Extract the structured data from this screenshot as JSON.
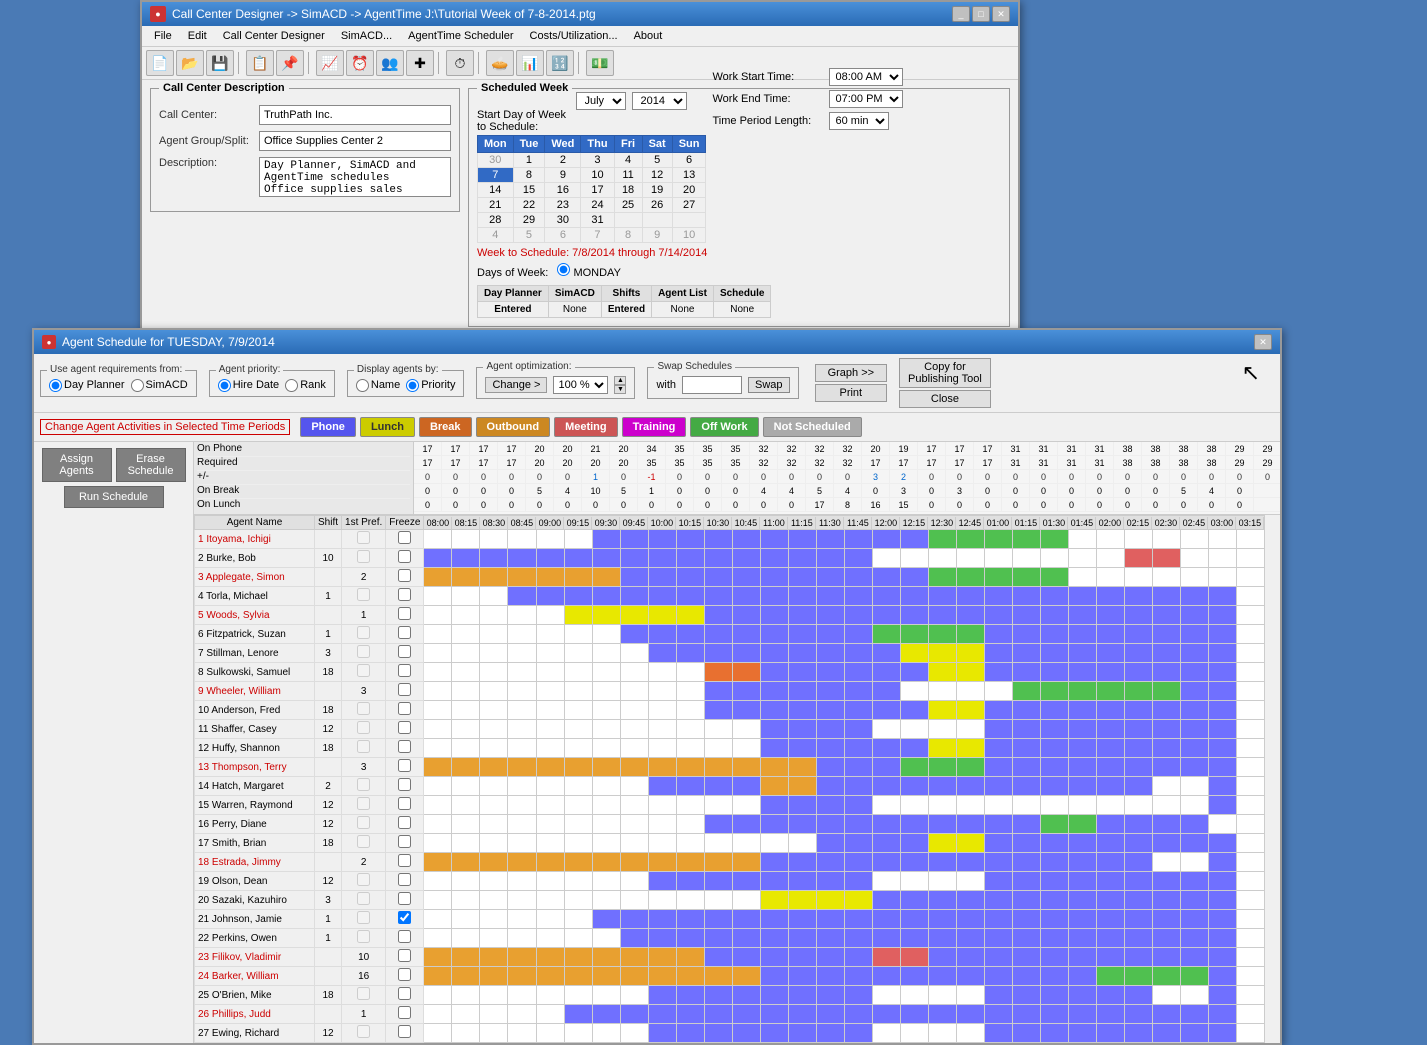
{
  "main_window": {
    "title": "Call Center Designer ->  SimACD ->  AgentTime    J:\\Tutorial Week of  7-8-2014.ptg",
    "icon": "●",
    "menus": [
      "File",
      "Edit",
      "Call Center Designer",
      "SimACD...",
      "AgentTime Scheduler",
      "Costs/Utilization...",
      "About"
    ],
    "cc_description": {
      "title": "Call Center Description",
      "call_center_label": "Call Center:",
      "call_center_value": "TruthPath Inc.",
      "agent_group_label": "Agent Group/Split:",
      "agent_group_value": "Office Supplies Center 2",
      "description_label": "Description:",
      "description_value": "Day Planner, SimACD and AgentTime schedules\nOffice supplies sales group."
    },
    "scheduled_week": {
      "title": "Scheduled Week",
      "month": "July",
      "year": "2014",
      "start_day_label": "Start Day of Week\nto Schedule:",
      "days": [
        "Mon",
        "Tue",
        "Wed",
        "Thu",
        "Fri",
        "Sat",
        "Sun"
      ],
      "weeks": [
        [
          "30",
          "1",
          "2",
          "3",
          "4",
          "5",
          "6"
        ],
        [
          "7",
          "8",
          "9",
          "10",
          "11",
          "12",
          "13"
        ],
        [
          "14",
          "15",
          "16",
          "17",
          "18",
          "19",
          "20"
        ],
        [
          "21",
          "22",
          "23",
          "24",
          "25",
          "26",
          "27"
        ],
        [
          "28",
          "29",
          "30",
          "31",
          "",
          "",
          ""
        ],
        [
          "4",
          "5",
          "6",
          "7",
          "8",
          "9",
          "10"
        ]
      ],
      "week_to_schedule": "Week to Schedule:  7/8/2014 through 7/14/2014",
      "days_of_week_label": "Days of Week:",
      "days_checkboxes": [
        "MONDAY"
      ],
      "work_start_label": "Work Start Time:",
      "work_start_value": "08:00 AM",
      "work_end_label": "Work End Time:",
      "work_end_value": "07:00 PM",
      "time_period_label": "Time Period Length:",
      "time_period_value": "60 min",
      "status_headers": [
        "Day Planner",
        "SimACD",
        "Shifts",
        "Agent List",
        "Schedule"
      ],
      "status_row1": [
        "Entered",
        "None",
        "Entered",
        "None",
        "None"
      ]
    }
  },
  "agent_window": {
    "title": "Agent Schedule for TUESDAY,  7/9/2014",
    "options": {
      "agent_req_label": "Use agent requirements from:",
      "day_planner": "Day Planner",
      "simacd": "SimACD",
      "agent_priority_label": "Agent priority:",
      "hire_date": "Hire Date",
      "rank": "Rank",
      "display_label": "Display agents by:",
      "name": "Name",
      "priority": "Priority",
      "optim_label": "Agent optimization:",
      "optim_value": "100 %",
      "change_label": "Change >"
    },
    "swap": {
      "label": "Swap Schedules",
      "with_label": "with",
      "swap_btn": "Swap"
    },
    "buttons": {
      "graph": "Graph >>",
      "print": "Print",
      "copy_publishing": "Copy for\nPublishing Tool",
      "close": "Close"
    },
    "change_activities_label": "Change Agent Activities in Selected Time Periods",
    "activity_buttons": [
      {
        "label": "Phone",
        "color": "#6666ff"
      },
      {
        "label": "Lunch",
        "color": "#e8e800"
      },
      {
        "label": "Break",
        "color": "#e87030"
      },
      {
        "label": "Outbound",
        "color": "#e8a030"
      },
      {
        "label": "Meeting",
        "color": "#e06060"
      },
      {
        "label": "Training",
        "color": "#e000e0"
      },
      {
        "label": "Off Work",
        "color": "#50c050"
      },
      {
        "label": "Not Scheduled",
        "color": "#c0c0c0"
      }
    ],
    "left_buttons": {
      "assign": "Assign\nAgents",
      "erase": "Erase\nSchedule",
      "run": "Run Schedule"
    },
    "stats": {
      "on_phone_label": "On Phone",
      "required_label": "Required",
      "plus_minus_label": "+/-",
      "on_break_label": "On Break",
      "on_lunch_label": "On Lunch",
      "time_slots": [
        "08:00",
        "08:15",
        "08:30",
        "08:45",
        "09:00",
        "09:15",
        "09:30",
        "09:45",
        "10:00",
        "10:15",
        "10:30",
        "10:45",
        "11:00",
        "11:15",
        "11:30",
        "11:45",
        "12:00",
        "12:15",
        "12:30",
        "12:45",
        "01:00",
        "01:15",
        "01:30",
        "01:45",
        "02:00",
        "02:15",
        "02:30",
        "02:45",
        "03:00",
        "03:15"
      ],
      "on_phone": [
        "17",
        "17",
        "17",
        "17",
        "20",
        "20",
        "21",
        "20",
        "34",
        "35",
        "35",
        "35",
        "32",
        "32",
        "32",
        "32",
        "20",
        "19",
        "17",
        "17",
        "17",
        "31",
        "31",
        "31",
        "31",
        "38",
        "38",
        "38",
        "38",
        "29",
        "29"
      ],
      "required": [
        "17",
        "17",
        "17",
        "17",
        "20",
        "20",
        "20",
        "20",
        "35",
        "35",
        "35",
        "35",
        "32",
        "32",
        "32",
        "32",
        "17",
        "17",
        "17",
        "17",
        "17",
        "31",
        "31",
        "31",
        "31",
        "38",
        "38",
        "38",
        "38",
        "29",
        "29"
      ],
      "plus_minus": [
        "0",
        "0",
        "0",
        "0",
        "0",
        "0",
        "1",
        "0",
        "-1",
        "0",
        "0",
        "0",
        "0",
        "0",
        "0",
        "0",
        "3",
        "2",
        "0",
        "0",
        "0",
        "0",
        "0",
        "0",
        "0",
        "0",
        "0",
        "0",
        "0",
        "0",
        "0"
      ],
      "on_break": [
        "0",
        "0",
        "0",
        "0",
        "5",
        "4",
        "10",
        "5",
        "1",
        "0",
        "0",
        "0",
        "4",
        "4",
        "5",
        "4",
        "0",
        "3",
        "0",
        "3",
        "0",
        "0",
        "0",
        "0",
        "0",
        "0",
        "0",
        "5",
        "4",
        "0"
      ],
      "on_lunch": [
        "0",
        "0",
        "0",
        "0",
        "0",
        "0",
        "0",
        "0",
        "0",
        "0",
        "0",
        "0",
        "0",
        "0",
        "17",
        "8",
        "16",
        "15",
        "0",
        "0",
        "0",
        "0",
        "0",
        "0",
        "0",
        "0",
        "0",
        "0",
        "0",
        "0"
      ]
    },
    "agents": [
      {
        "num": 1,
        "name": "Itoyama, Ichigi",
        "shift": "",
        "pref": "",
        "freeze": false,
        "color": "row-red"
      },
      {
        "num": 2,
        "name": "Burke, Bob",
        "shift": "10",
        "pref": "",
        "freeze": false,
        "color": ""
      },
      {
        "num": 3,
        "name": "Applegate, Simon",
        "shift": "",
        "pref": "2",
        "freeze": false,
        "color": "row-red"
      },
      {
        "num": 4,
        "name": "Torla, Michael",
        "shift": "1",
        "pref": "",
        "freeze": false,
        "color": ""
      },
      {
        "num": 5,
        "name": "Woods, Sylvia",
        "shift": "",
        "pref": "1",
        "freeze": false,
        "color": "row-red"
      },
      {
        "num": 6,
        "name": "Fitzpatrick, Suzan",
        "shift": "1",
        "pref": "",
        "freeze": false,
        "color": ""
      },
      {
        "num": 7,
        "name": "Stillman, Lenore",
        "shift": "3",
        "pref": "",
        "freeze": false,
        "color": ""
      },
      {
        "num": 8,
        "name": "Sulkowski, Samuel",
        "shift": "18",
        "pref": "",
        "freeze": false,
        "color": ""
      },
      {
        "num": 9,
        "name": "Wheeler, William",
        "shift": "",
        "pref": "3",
        "freeze": false,
        "color": "row-red"
      },
      {
        "num": 10,
        "name": "Anderson, Fred",
        "shift": "18",
        "pref": "",
        "freeze": false,
        "color": ""
      },
      {
        "num": 11,
        "name": "Shaffer, Casey",
        "shift": "12",
        "pref": "",
        "freeze": false,
        "color": ""
      },
      {
        "num": 12,
        "name": "Huffy, Shannon",
        "shift": "18",
        "pref": "",
        "freeze": false,
        "color": ""
      },
      {
        "num": 13,
        "name": "Thompson, Terry",
        "shift": "",
        "pref": "3",
        "freeze": false,
        "color": "row-red"
      },
      {
        "num": 14,
        "name": "Hatch, Margaret",
        "shift": "2",
        "pref": "",
        "freeze": false,
        "color": ""
      },
      {
        "num": 15,
        "name": "Warren, Raymond",
        "shift": "12",
        "pref": "",
        "freeze": false,
        "color": ""
      },
      {
        "num": 16,
        "name": "Perry, Diane",
        "shift": "12",
        "pref": "",
        "freeze": false,
        "color": ""
      },
      {
        "num": 17,
        "name": "Smith, Brian",
        "shift": "18",
        "pref": "",
        "freeze": false,
        "color": ""
      },
      {
        "num": 18,
        "name": "Estrada, Jimmy",
        "shift": "",
        "pref": "2",
        "freeze": false,
        "color": "row-red"
      },
      {
        "num": 19,
        "name": "Olson, Dean",
        "shift": "12",
        "pref": "",
        "freeze": false,
        "color": ""
      },
      {
        "num": 20,
        "name": "Sazaki, Kazuhiro",
        "shift": "3",
        "pref": "",
        "freeze": false,
        "color": ""
      },
      {
        "num": 21,
        "name": "Johnson, Jamie",
        "shift": "1",
        "pref": "",
        "freeze": true,
        "color": ""
      },
      {
        "num": 22,
        "name": "Perkins, Owen",
        "shift": "1",
        "pref": "",
        "freeze": false,
        "color": ""
      },
      {
        "num": 23,
        "name": "Filikov, Vladimir",
        "shift": "",
        "pref": "10",
        "freeze": false,
        "color": "row-red"
      },
      {
        "num": 24,
        "name": "Barker, William",
        "shift": "",
        "pref": "16",
        "freeze": false,
        "color": "row-red"
      },
      {
        "num": 25,
        "name": "O'Brien, Mike",
        "shift": "18",
        "pref": "",
        "freeze": false,
        "color": ""
      },
      {
        "num": 26,
        "name": "Phillips, Judd",
        "shift": "",
        "pref": "1",
        "freeze": false,
        "color": "row-red"
      },
      {
        "num": 27,
        "name": "Ewing, Richard",
        "shift": "12",
        "pref": "",
        "freeze": false,
        "color": ""
      }
    ],
    "col_headers": [
      "Agent Name",
      "Shift",
      "1st Pref.",
      "Freeze"
    ]
  }
}
